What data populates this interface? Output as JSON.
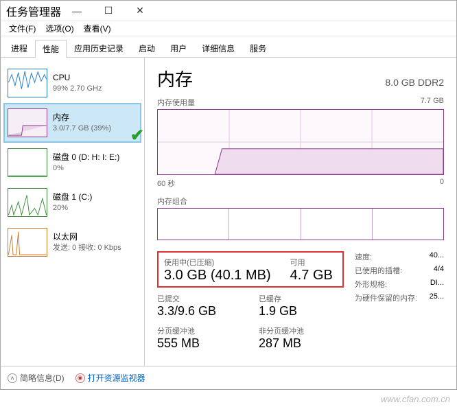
{
  "window": {
    "title": "任务管理器"
  },
  "menu": {
    "file": "文件(F)",
    "options": "选项(O)",
    "view": "查看(V)"
  },
  "tabs": {
    "processes": "进程",
    "performance": "性能",
    "app_history": "应用历史记录",
    "startup": "启动",
    "users": "用户",
    "details": "详细信息",
    "services": "服务"
  },
  "sidebar": {
    "cpu": {
      "title": "CPU",
      "sub": "99%  2.70 GHz"
    },
    "memory": {
      "title": "内存",
      "sub": "3.0/7.7 GB (39%)"
    },
    "disk0": {
      "title": "磁盘 0 (D: H: I: E:)",
      "sub": "0%"
    },
    "disk1": {
      "title": "磁盘 1 (C:)",
      "sub": "20%"
    },
    "ethernet": {
      "title": "以太网",
      "sub": "发送: 0  接收: 0 Kbps"
    }
  },
  "main": {
    "title": "内存",
    "subtitle": "8.0 GB DDR2",
    "usage_label": "内存使用量",
    "usage_max": "7.7 GB",
    "axis_left": "60 秒",
    "axis_right": "0",
    "composition_label": "内存组合",
    "in_use_label": "使用中(已压缩)",
    "in_use_value": "3.0 GB (40.1 MB)",
    "available_label": "可用",
    "available_value": "4.7 GB",
    "committed_label": "已提交",
    "committed_value": "3.3/9.6 GB",
    "cached_label": "已缓存",
    "cached_value": "1.9 GB",
    "paged_label": "分页缓冲池",
    "paged_value": "555 MB",
    "nonpaged_label": "非分页缓冲池",
    "nonpaged_value": "287 MB",
    "info": {
      "speed_k": "速度:",
      "speed_v": "40...",
      "slots_k": "已使用的插槽:",
      "slots_v": "4/4",
      "form_k": "外形规格:",
      "form_v": "DI...",
      "reserved_k": "为硬件保留的内存:",
      "reserved_v": "25..."
    }
  },
  "footer": {
    "fewer": "简略信息(D)",
    "resmon": "打开资源监视器"
  },
  "watermark": "www.cfan.com.cn",
  "chart_data": {
    "type": "area",
    "title": "内存使用量",
    "xlabel": "60 秒",
    "ylabel": "",
    "ylim": [
      0,
      7.7
    ],
    "x": [
      0,
      10,
      20,
      22,
      60
    ],
    "values": [
      0,
      0,
      0,
      3.0,
      3.0
    ],
    "unit": "GB"
  }
}
